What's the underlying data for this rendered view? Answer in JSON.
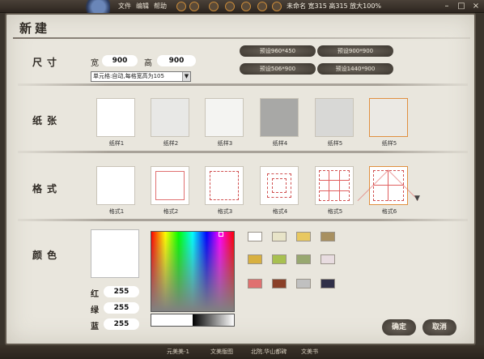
{
  "topbar": {
    "menus": [
      "文件",
      "编辑",
      "帮助"
    ],
    "status": "未命名 宽315 高315 放大100%",
    "window_buttons": [
      "minimize-icon",
      "maximize-icon",
      "close-icon"
    ]
  },
  "dialog": {
    "title": "新建",
    "size": {
      "label": "尺寸",
      "width_label": "宽",
      "width_value": "900",
      "height_label": "高",
      "height_value": "900",
      "unit_select": "单元格:自动,每格宽高为105"
    },
    "presets": [
      "预设960*450",
      "预设900*900",
      "预设506*900",
      "预设1440*900"
    ],
    "paper": {
      "label": "纸张",
      "items": [
        {
          "label": "纸样1",
          "tone": "#ffffff",
          "selected": false
        },
        {
          "label": "纸样2",
          "tone": "#e8e8e6",
          "selected": false
        },
        {
          "label": "纸样3",
          "tone": "#f4f4f2",
          "selected": false
        },
        {
          "label": "纸样4",
          "tone": "#a8a8a6",
          "selected": false
        },
        {
          "label": "纸样5",
          "tone": "#d8d8d6",
          "selected": false
        },
        {
          "label": "纸样5",
          "tone": "#ebe9e4",
          "selected": true
        }
      ]
    },
    "format": {
      "label": "格式",
      "items": [
        "格式1",
        "格式2",
        "格式3",
        "格式4",
        "格式5",
        "格式6"
      ],
      "selected_index": 5
    },
    "color": {
      "label": "颜色",
      "red_label": "红",
      "red": "255",
      "green_label": "绿",
      "green": "255",
      "blue_label": "蓝",
      "blue": "255",
      "preset_colors": [
        "#ffffff",
        "#e8e4c8",
        "#e8c860",
        "#a89060",
        "#d8b040",
        "#a8c050",
        "#98a870",
        "#e8dce0",
        "#e07070",
        "#8a4028",
        "#c0c0c0",
        "#303048"
      ]
    },
    "ok_label": "确定",
    "cancel_label": "取消"
  },
  "taskbar": {
    "items": [
      "元美美-1",
      "文美版图",
      "北院.华山都碑",
      "文美书"
    ]
  }
}
